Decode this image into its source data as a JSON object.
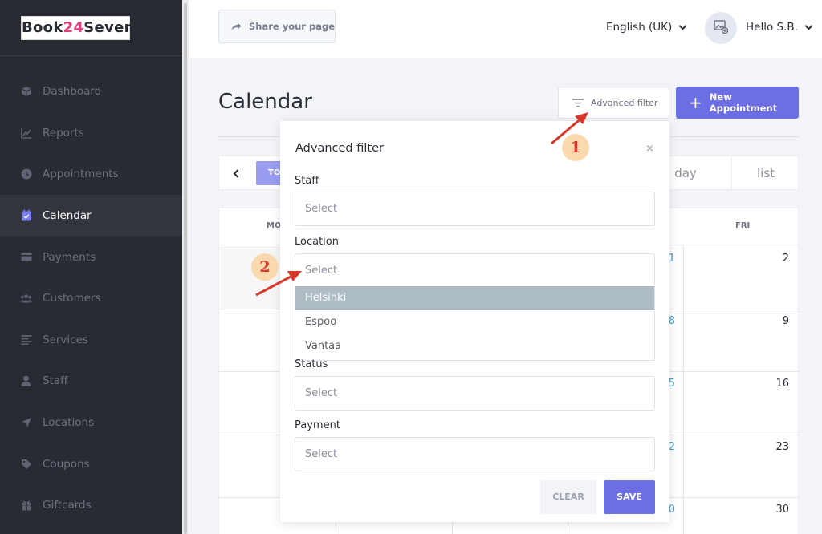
{
  "app": {
    "logo_part1": "Book",
    "logo_accent": "24",
    "logo_part2": "Seven"
  },
  "sidebar": {
    "items": [
      {
        "label": "Dashboard",
        "icon": "box-icon"
      },
      {
        "label": "Reports",
        "icon": "chart-icon"
      },
      {
        "label": "Appointments",
        "icon": "clock-icon"
      },
      {
        "label": "Calendar",
        "icon": "calendar-icon",
        "active": true
      },
      {
        "label": "Payments",
        "icon": "wallet-icon"
      },
      {
        "label": "Customers",
        "icon": "users-icon"
      },
      {
        "label": "Services",
        "icon": "list-icon"
      },
      {
        "label": "Staff",
        "icon": "user-icon"
      },
      {
        "label": "Locations",
        "icon": "location-arrow-icon"
      },
      {
        "label": "Coupons",
        "icon": "tag-icon"
      },
      {
        "label": "Giftcards",
        "icon": "gift-icon"
      }
    ]
  },
  "topbar": {
    "share_label": "Share your page",
    "language": "English (UK)",
    "greeting": "Hello S.B."
  },
  "page": {
    "title": "Calendar",
    "advanced_filter_label": "Advanced filter",
    "new_appointment_label": "New Appointment"
  },
  "calendar": {
    "today_label": "TO",
    "view_day": "day",
    "view_list": "list",
    "days_of_week": [
      "MO",
      "FRI"
    ],
    "fri_dates": [
      "2",
      "9",
      "16",
      "23",
      "30"
    ],
    "partial_dates": [
      "1",
      "8",
      "5",
      "2",
      "0"
    ]
  },
  "modal": {
    "title": "Advanced filter",
    "close": "×",
    "staff_label": "Staff",
    "staff_placeholder": "Select",
    "location_label": "Location",
    "location_placeholder": "Select",
    "location_options": [
      "Helsinki",
      "Espoo",
      "Vantaa"
    ],
    "status_label": "Status",
    "status_placeholder": "Select",
    "payment_label": "Payment",
    "payment_placeholder": "Select",
    "clear_label": "CLEAR",
    "save_label": "SAVE"
  },
  "annotations": {
    "step1": "1",
    "step2": "2"
  },
  "colors": {
    "sidebar_bg": "#292b33",
    "accent": "#6c6fe3",
    "highlight_option": "#aebdc4",
    "annotation_arrow": "#d9372a",
    "annotation_badge": "#fbd9ae"
  }
}
